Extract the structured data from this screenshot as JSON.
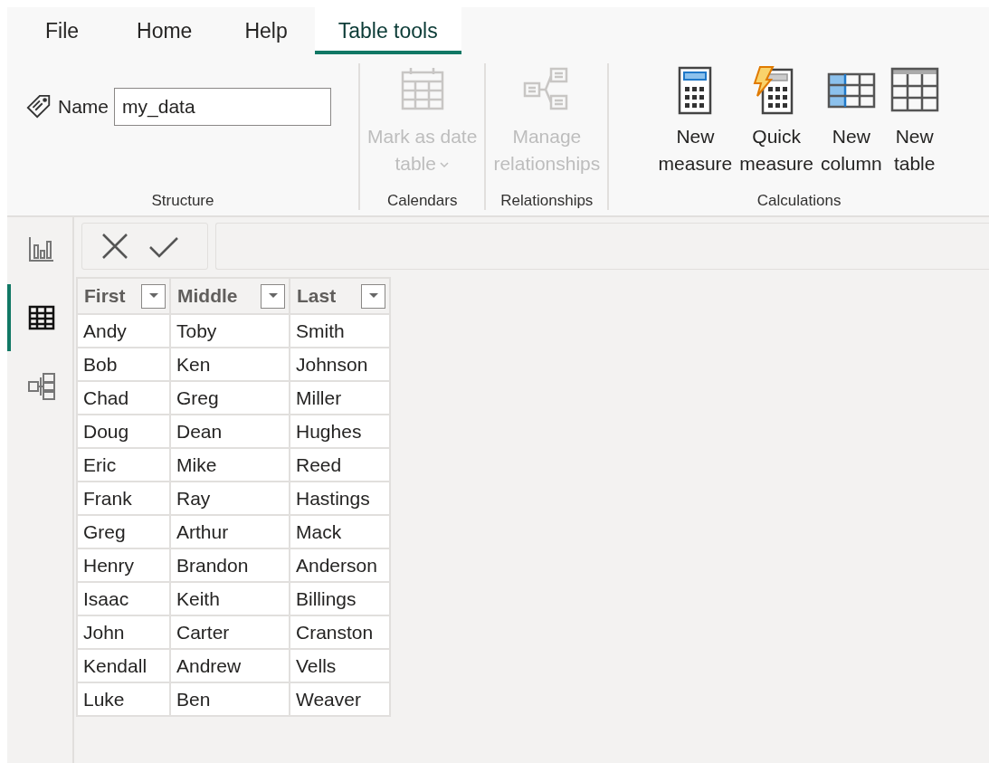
{
  "tabs": [
    {
      "label": "File",
      "selected": false
    },
    {
      "label": "Home",
      "selected": false
    },
    {
      "label": "Help",
      "selected": false
    },
    {
      "label": "Table tools",
      "selected": true
    }
  ],
  "ribbon": {
    "groups": [
      {
        "kind": "name",
        "label": "Structure",
        "field_label": "Name",
        "value": "my_data"
      },
      {
        "kind": "buttons",
        "label": "Calendars",
        "buttons": [
          {
            "label": "Mark as date\ntable",
            "disabled": true,
            "dropdown": true
          }
        ]
      },
      {
        "kind": "buttons",
        "label": "Relationships",
        "buttons": [
          {
            "label": "Manage\nrelationships",
            "disabled": true,
            "dropdown": false
          }
        ]
      },
      {
        "kind": "buttons",
        "label": "Calculations",
        "buttons": [
          {
            "label": "New\nmeasure",
            "disabled": false,
            "dropdown": false
          },
          {
            "label": "Quick\nmeasure",
            "disabled": false,
            "dropdown": false
          },
          {
            "label": "New\ncolumn",
            "disabled": false,
            "dropdown": false
          },
          {
            "label": "New\ntable",
            "disabled": false,
            "dropdown": false
          }
        ]
      }
    ]
  },
  "sidebar": {
    "items": [
      {
        "selected": false
      },
      {
        "selected": true
      },
      {
        "selected": false
      }
    ]
  },
  "table": {
    "columns": [
      "First",
      "Middle",
      "Last"
    ],
    "rows": [
      [
        "Andy",
        "Toby",
        "Smith"
      ],
      [
        "Bob",
        "Ken",
        "Johnson"
      ],
      [
        "Chad",
        "Greg",
        "Miller"
      ],
      [
        "Doug",
        "Dean",
        "Hughes"
      ],
      [
        "Eric",
        "Mike",
        "Reed"
      ],
      [
        "Frank",
        "Ray",
        "Hastings"
      ],
      [
        "Greg",
        "Arthur",
        "Mack"
      ],
      [
        "Henry",
        "Brandon",
        "Anderson"
      ],
      [
        "Isaac",
        "Keith",
        "Billings"
      ],
      [
        "John",
        "Carter",
        "Cranston"
      ],
      [
        "Kendall",
        "Andrew",
        "Vells"
      ],
      [
        "Luke",
        "Ben",
        "Weaver"
      ]
    ]
  }
}
